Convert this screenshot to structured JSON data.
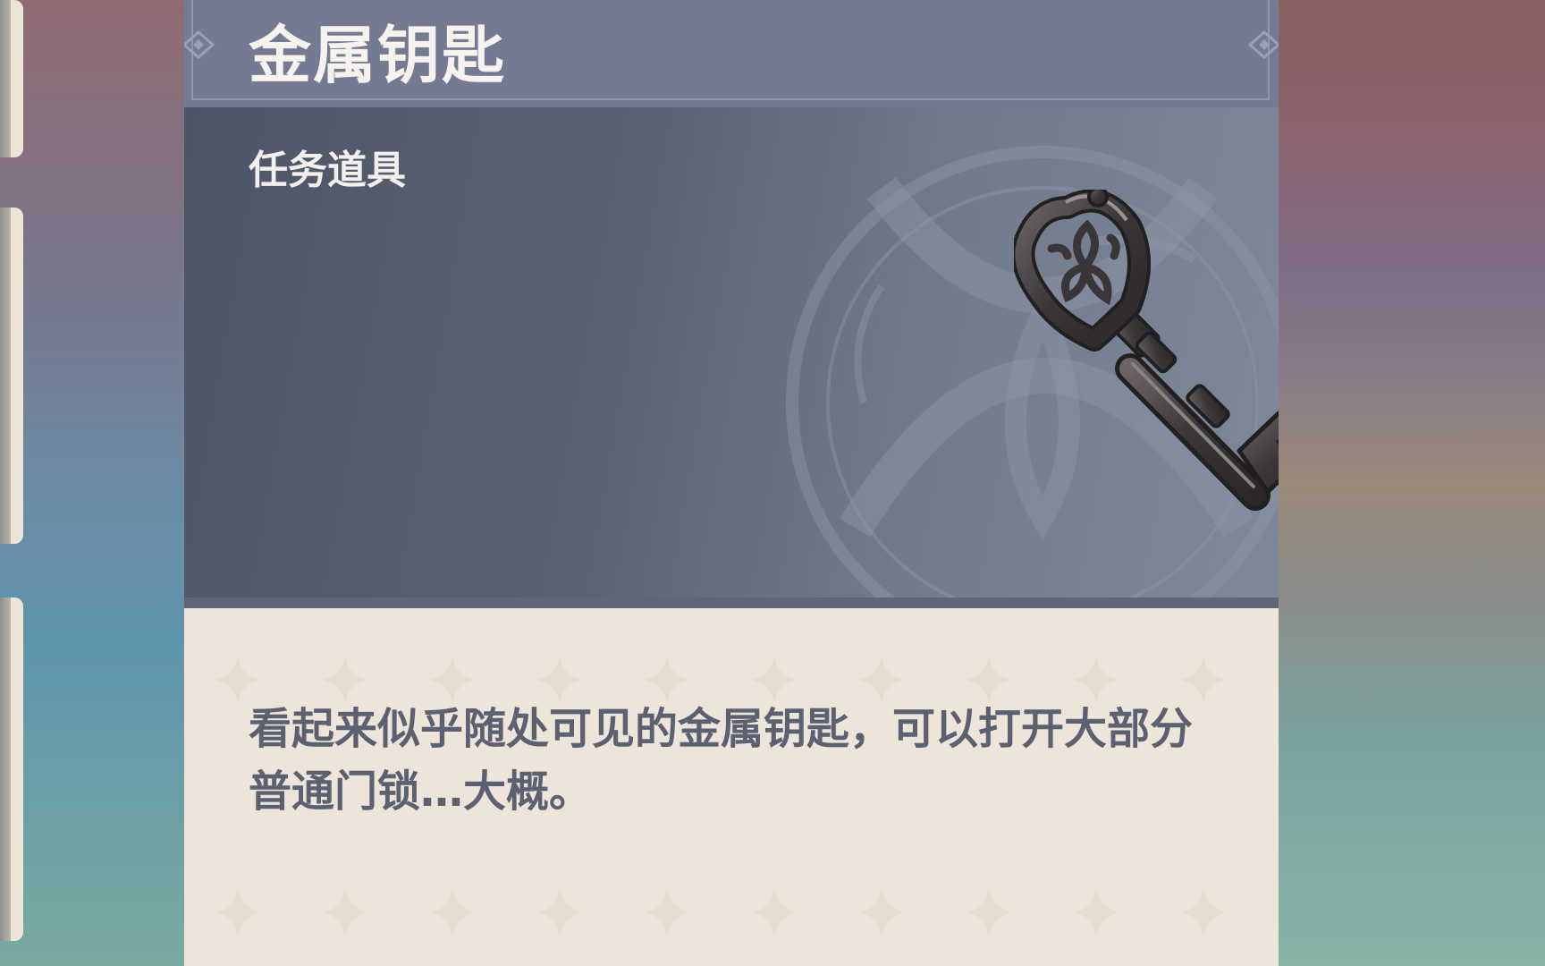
{
  "item": {
    "name": "金属钥匙",
    "category": "任务道具",
    "description": "看起来似乎随处可见的金属钥匙，可以打开大部分普通门锁…大概。",
    "icon": "metal-key"
  },
  "colors": {
    "title_bar": "#737a92",
    "art_background": "#5a6274",
    "description_background": "#ede5d9",
    "description_text": "#5b6170",
    "title_text": "#f6f3ee"
  }
}
